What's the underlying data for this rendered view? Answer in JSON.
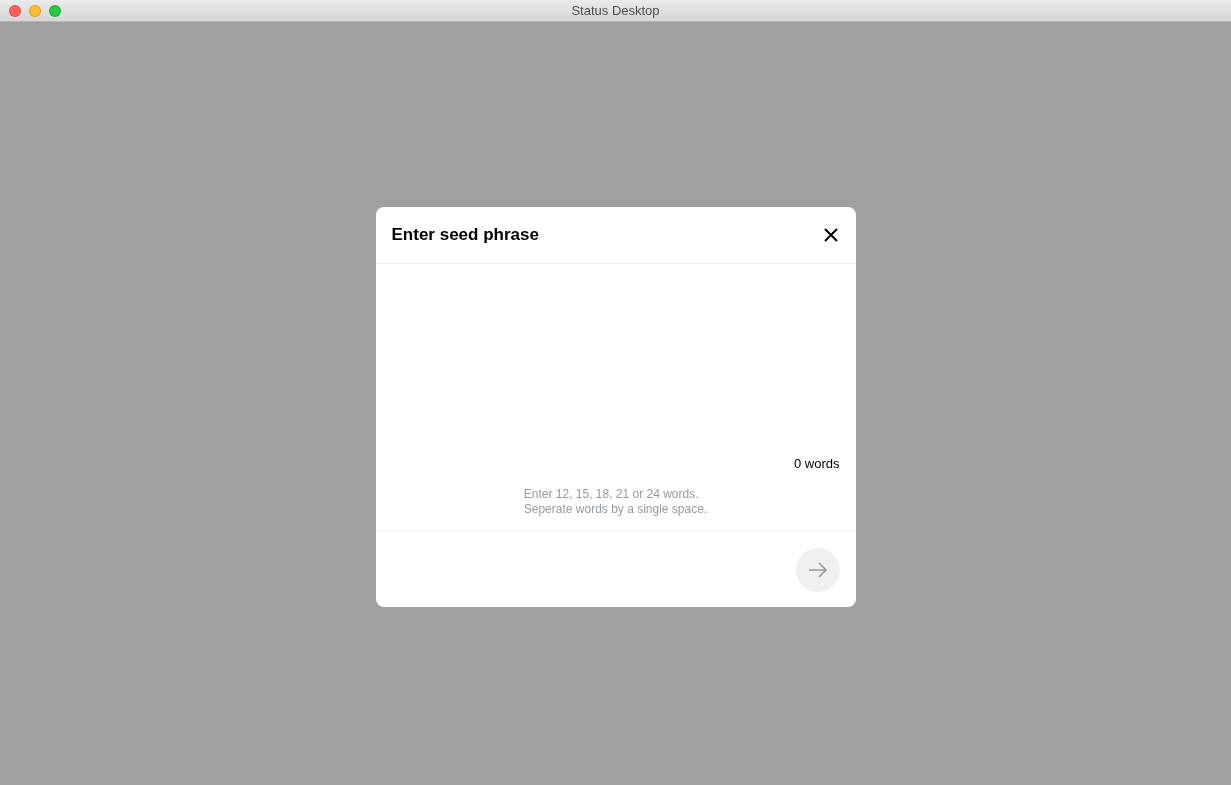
{
  "window": {
    "title": "Status Desktop"
  },
  "dialog": {
    "title": "Enter seed phrase",
    "word_count": "0 words",
    "hint": [
      "Enter 12, 15, 18, 21 or 24 words.",
      "Seperate words by a single space."
    ],
    "next_button": {
      "disabled": true
    }
  }
}
